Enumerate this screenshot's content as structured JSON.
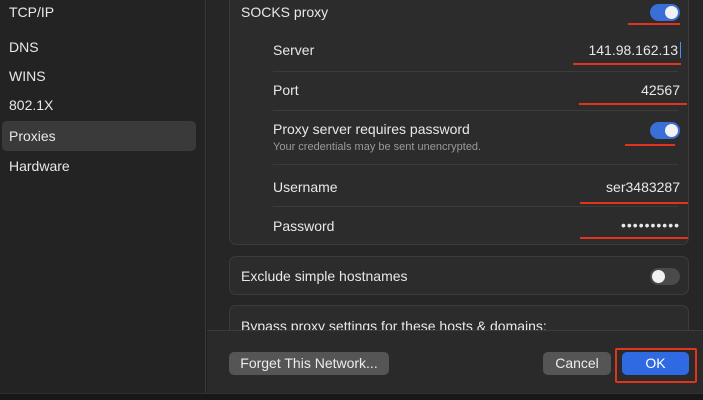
{
  "sidebar": {
    "items": [
      {
        "label": "TCP/IP"
      },
      {
        "label": "DNS"
      },
      {
        "label": "WINS"
      },
      {
        "label": "802.1X"
      },
      {
        "label": "Proxies"
      },
      {
        "label": "Hardware"
      }
    ]
  },
  "socks": {
    "label": "SOCKS proxy",
    "enabled": true,
    "server_label": "Server",
    "server_value": "141.98.162.13",
    "port_label": "Port",
    "port_value": "42567",
    "auth_label": "Proxy server requires password",
    "auth_note": "Your credentials may be sent unencrypted.",
    "auth_enabled": true,
    "username_label": "Username",
    "username_value": "ser3483287",
    "password_label": "Password",
    "password_value": "••••••••••"
  },
  "exclude": {
    "label": "Exclude simple hostnames",
    "enabled": false
  },
  "bypass": {
    "label": "Bypass proxy settings for these hosts & domains:"
  },
  "footer": {
    "forget_label": "Forget This Network...",
    "cancel_label": "Cancel",
    "ok_label": "OK"
  },
  "colors": {
    "accent": "#2f6ae3",
    "annotation": "#e0341c"
  }
}
